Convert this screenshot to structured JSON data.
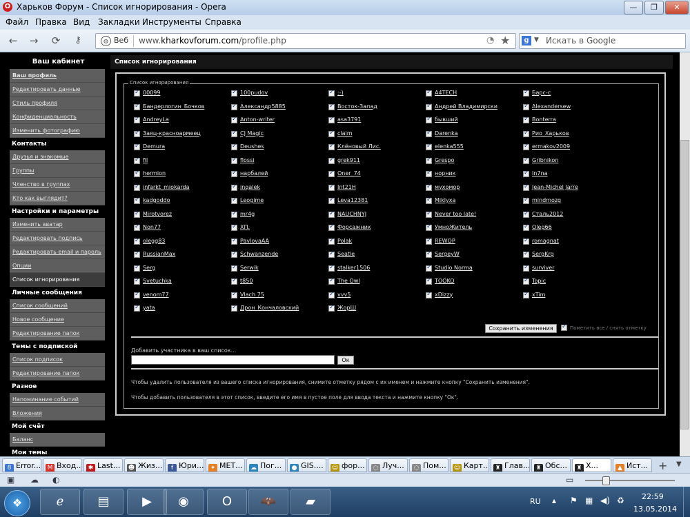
{
  "window": {
    "title": "Харьков Форум - Список игнорирования - Opera",
    "controls": {
      "minimize": "—",
      "maximize": "❐",
      "close": "✕"
    }
  },
  "menu": [
    "Файл",
    "Правка",
    "Вид",
    "Закладки",
    "Инструменты",
    "Справка"
  ],
  "address_bar": {
    "web_label": "Веб",
    "url_prefix": "www.",
    "url_domain": "kharkovforum.com",
    "url_path": "/profile.php"
  },
  "search": {
    "engine": "g",
    "placeholder": "Искать в Google"
  },
  "sidebar": {
    "title": "Ваш кабинет",
    "sections": [
      {
        "type": "item",
        "label": "Ваш профиль",
        "bold": true
      },
      {
        "type": "item",
        "label": "Редактировать данные"
      },
      {
        "type": "item",
        "label": "Стиль профиля"
      },
      {
        "type": "item",
        "label": "Конфиденциальность"
      },
      {
        "type": "item",
        "label": "Изменить фотографию"
      },
      {
        "type": "head",
        "label": "Контакты"
      },
      {
        "type": "item",
        "label": "Друзья и знакомые"
      },
      {
        "type": "item",
        "label": "Группы"
      },
      {
        "type": "item",
        "label": "Членство в группах"
      },
      {
        "type": "item",
        "label": "Кто как выглядит?"
      },
      {
        "type": "head",
        "label": "Настройки и параметры"
      },
      {
        "type": "item",
        "label": "Изменить аватар"
      },
      {
        "type": "item",
        "label": "Редактировать подпись"
      },
      {
        "type": "item",
        "label": "Редактировать email и пароль"
      },
      {
        "type": "item",
        "label": "Опции"
      },
      {
        "type": "item",
        "label": "Список игнорирования",
        "active": true
      },
      {
        "type": "head",
        "label": "Личные сообщения"
      },
      {
        "type": "item",
        "label": "Список сообщений"
      },
      {
        "type": "item",
        "label": "Новое сообщение"
      },
      {
        "type": "item",
        "label": "Редактирование папок"
      },
      {
        "type": "head",
        "label": "Темы с подпиской"
      },
      {
        "type": "item",
        "label": "Список подписок"
      },
      {
        "type": "item",
        "label": "Редактирование папок"
      },
      {
        "type": "head",
        "label": "Разное"
      },
      {
        "type": "item",
        "label": "Напоминание событий"
      },
      {
        "type": "item",
        "label": "Вложения"
      },
      {
        "type": "head",
        "label": "Мой счёт"
      },
      {
        "type": "item",
        "label": "Баланс"
      },
      {
        "type": "head",
        "label": "Мои темы"
      }
    ]
  },
  "main": {
    "header": "Список игнорирования",
    "legend": "Список игнорирования",
    "ignore_columns": [
      [
        "00099",
        "Бандерлогин_Бочков",
        "AndreyLa",
        "Заяц-красноармеец",
        "Demura",
        "fil",
        "hermion",
        "infarkt_miokarda",
        "kadgoddo",
        "Mirotvorez",
        "Non77",
        "olegg83",
        "RussianMax",
        "Serg",
        "Svetuchka",
        "venom77",
        "yata"
      ],
      [
        "100pudov",
        "Александр5885",
        "Anton-writer",
        "CJ Magic",
        "Deushes",
        "flossi",
        "нарбалей",
        "inqalek",
        "Leogime",
        "mr4g",
        "ХП.",
        "PavlovaAA",
        "Schwanzende",
        "Serwik",
        "t850",
        "Vlach 75",
        "Дрон_Кончаловский"
      ],
      [
        ":-)",
        "Восток-Запад",
        "asa3791",
        "claim",
        "Клёновый Лис.",
        "grek911",
        "Oner_74",
        "Int21H",
        "Leva12381",
        "NAUCHNYJ",
        "Форсажник",
        "Polak",
        "Seatle",
        "stalker1506",
        "The Owl",
        "vvv5",
        "ЖорШ"
      ],
      [
        "A4TECH",
        "Андрей Владимирски",
        "бывший",
        "Darenka",
        "elenka555",
        "Grespo",
        "норник",
        "мухомор",
        "Miklyxa",
        "Never too late!",
        "УмноЖитель",
        "REWOP",
        "SergeyW",
        "Studio Norma",
        "TOOKO",
        "xDizzy"
      ],
      [
        "Барс-с",
        "Alexandersew",
        "Bonterra",
        "Рио_Харьков",
        "ermakov2009",
        "Gribnikon",
        "In7na",
        "Jean-Michel Jarre",
        "mindmozg",
        "Сталь2012",
        "Oleg66",
        "romagnat",
        "SergKrg",
        "surviver",
        "Topic",
        "xTim"
      ]
    ],
    "save_button": "Сохранить изменения",
    "mark_all_label": "Пометить все / снять отметку",
    "add_label": "Добавить участника в ваш список...",
    "add_input_value": "",
    "ok_button": "Ок",
    "info_remove": "Чтобы удалить пользователя из вашего списка игнорирования, снимите отметку рядом с их именем и нажмите кнопку \"Сохранить изменения\".",
    "info_add": "Чтобы добавить пользователя в этот список, введите его имя в пустое поле для ввода текста и нажмите кнопку \"Ок\"."
  },
  "tabs": [
    {
      "label": "Error...",
      "icon": "8",
      "color": "#3b76d6"
    },
    {
      "label": "Вход...",
      "icon": "M",
      "color": "#d93025"
    },
    {
      "label": "Last...",
      "icon": "✱",
      "color": "#c4161c"
    },
    {
      "label": "Жиз...",
      "icon": "☻",
      "color": "#555555"
    },
    {
      "label": "Юри...",
      "icon": "f",
      "color": "#3b5998"
    },
    {
      "label": "МЕТ...",
      "icon": "✦",
      "color": "#e67e22"
    },
    {
      "label": "Пог...",
      "icon": "☁",
      "color": "#2e86c1"
    },
    {
      "label": "GIS....",
      "icon": "●",
      "color": "#2e86c1"
    },
    {
      "label": "фор...",
      "icon": "☺",
      "color": "#b7950b"
    },
    {
      "label": "Луч...",
      "icon": "◌",
      "color": "#888888"
    },
    {
      "label": "Пом...",
      "icon": "◌",
      "color": "#888888"
    },
    {
      "label": "Карт...",
      "icon": "☺",
      "color": "#b7950b"
    },
    {
      "label": "Глав...",
      "icon": "♜",
      "color": "#222222"
    },
    {
      "label": "Обс...",
      "icon": "♜",
      "color": "#222222"
    },
    {
      "label": "Х...",
      "icon": "♜",
      "color": "#222222",
      "active": true
    },
    {
      "label": "Ист...",
      "icon": "▲",
      "color": "#e67e22"
    }
  ],
  "taskbar": {
    "lang": "RU",
    "time": "22:59",
    "date": "13.05.2014",
    "apps": [
      "ie-icon",
      "explorer-icon",
      "media-player-icon",
      "chrome-icon",
      "opera-icon",
      "batman-icon",
      "sticky-notes-icon"
    ]
  }
}
